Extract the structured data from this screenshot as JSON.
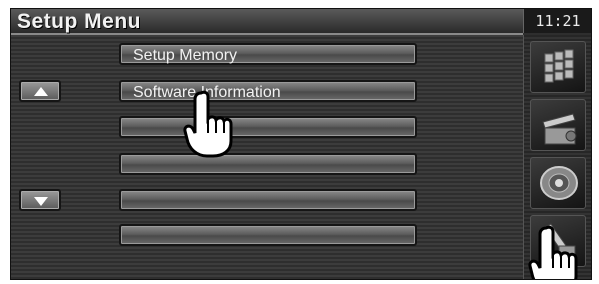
{
  "header": {
    "title": "Setup Menu",
    "clock": "11:21"
  },
  "menu": {
    "items": [
      {
        "label": "Setup Memory"
      },
      {
        "label": "Software Information"
      },
      {
        "label": ""
      },
      {
        "label": ""
      },
      {
        "label": ""
      },
      {
        "label": ""
      }
    ]
  },
  "side_buttons": [
    {
      "icon": "grid-menu-icon"
    },
    {
      "icon": "clapperboard-icon"
    },
    {
      "icon": "speaker-icon"
    },
    {
      "icon": "wrench-icon"
    }
  ],
  "colors": {
    "background": "#333333",
    "button_text": "#f2f2f2"
  }
}
